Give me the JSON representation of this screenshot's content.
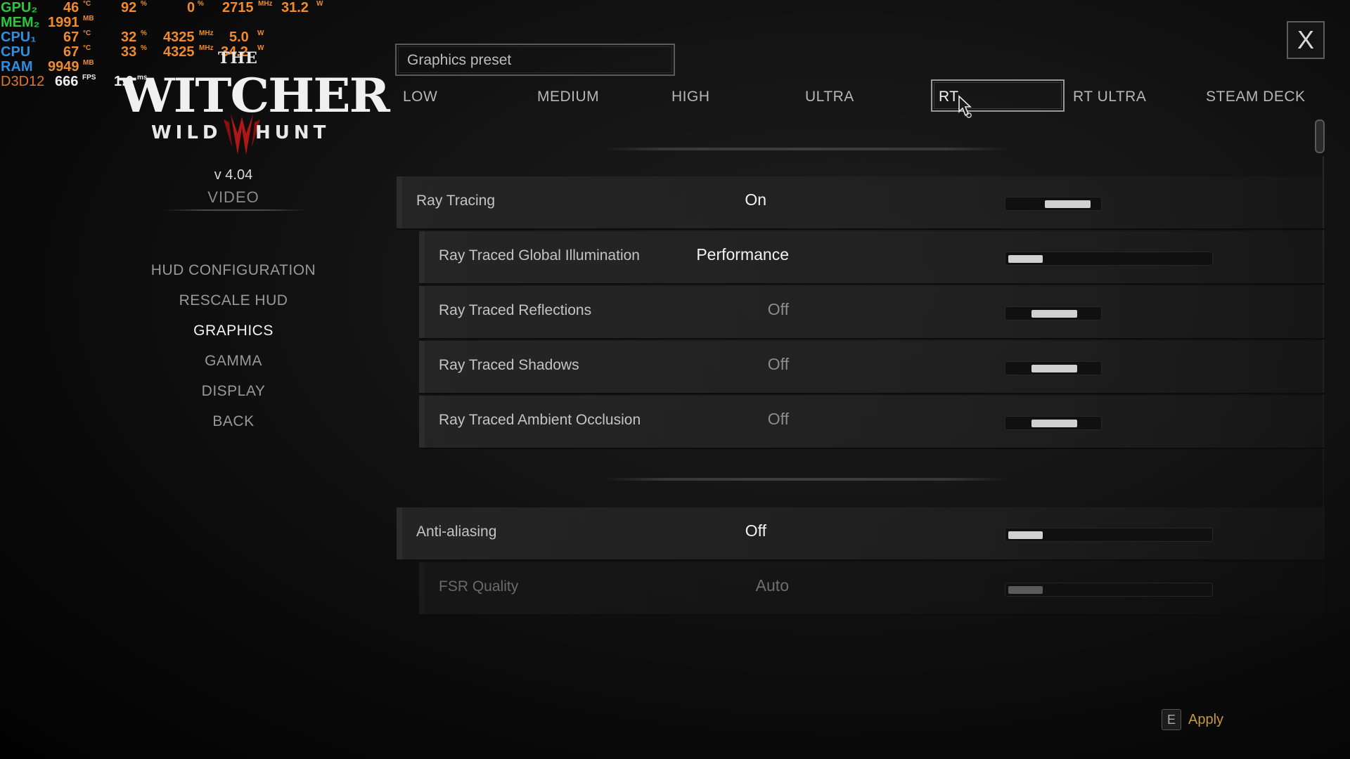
{
  "osd": {
    "rows": [
      {
        "label": "GPU₂",
        "v1": "46",
        "u1": "°C",
        "v2": "92",
        "u2": "%",
        "v3": "0",
        "u3": "%",
        "v4": "2715",
        "u4": "MHz",
        "v5": "31.2",
        "u5": "W"
      },
      {
        "label": "MEM₂",
        "v1": "1991",
        "u1": "MB"
      },
      {
        "label": "CPU₁",
        "v1": "67",
        "u1": "°C",
        "v2": "32",
        "u2": "%",
        "v4": "4325",
        "u4": "MHz",
        "v5": "5.0",
        "u5": "W"
      },
      {
        "label": "CPU",
        "v1": "67",
        "u1": "°C",
        "v2": "33",
        "u2": "%",
        "v4": "4325",
        "u4": "MHz",
        "v5": "34.2",
        "u5": "W"
      },
      {
        "label": "RAM",
        "v1": "9949",
        "u1": "MB"
      },
      {
        "label": "D3D12",
        "v1": "666",
        "u1": "FPS",
        "v2": "1.6",
        "u2": "ms"
      }
    ]
  },
  "logo": {
    "the": "THE",
    "main": "WITCHER",
    "wild": "WILD",
    "hunt": "HUNT"
  },
  "version": "v 4.04",
  "section_title": "VIDEO",
  "menu": [
    "HUD CONFIGURATION",
    "RESCALE HUD",
    "GRAPHICS",
    "GAMMA",
    "DISPLAY",
    "BACK"
  ],
  "menu_active": "GRAPHICS",
  "preset": {
    "label": "Graphics preset",
    "options": [
      "LOW",
      "MEDIUM",
      "HIGH",
      "ULTRA",
      "RT",
      "RT ULTRA",
      "STEAM DECK"
    ],
    "selected": "RT"
  },
  "settings": [
    {
      "label": "Ray Tracing",
      "value": "On",
      "level": 0.8
    },
    {
      "label": "Ray Traced Global Illumination",
      "value": "Performance",
      "level": 0.2
    },
    {
      "label": "Ray Traced Reflections",
      "value": "Off",
      "level": 0.5
    },
    {
      "label": "Ray Traced Shadows",
      "value": "Off",
      "level": 0.5
    },
    {
      "label": "Ray Traced Ambient Occlusion",
      "value": "Off",
      "level": 0.5
    },
    {
      "label": "Anti-aliasing",
      "value": "Off",
      "level": 0.2
    },
    {
      "label": "FSR Quality",
      "value": "Auto",
      "level": 0.2
    }
  ],
  "apply": {
    "key": "E",
    "label": "Apply"
  },
  "close_label": "X",
  "colors": {
    "apply": "#c79a3a",
    "osd_green": "#2fc43a",
    "osd_blue": "#2e8ee0",
    "osd_orange": "#f08a2a",
    "osd_label_orange": "#e0782a"
  },
  "icons": {
    "close": "close-icon",
    "cursor": "mouse-cursor-icon",
    "scroll": "scrollbar-thumb"
  }
}
